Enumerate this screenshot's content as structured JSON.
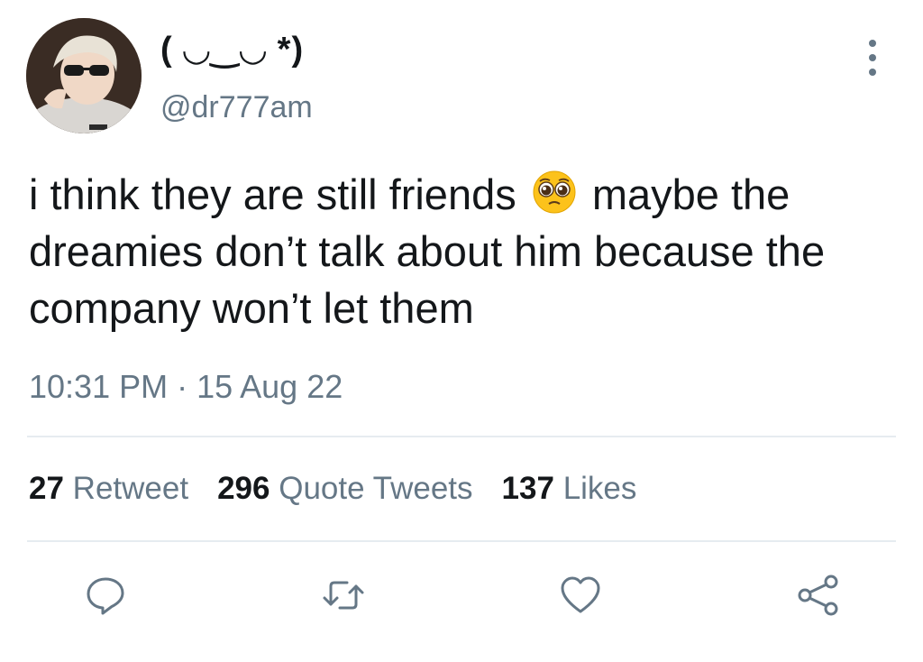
{
  "user": {
    "display_name": "( ◡‿◡ *)",
    "handle": "@dr777am"
  },
  "tweet": {
    "text_before_emoji": "i think they are still friends",
    "emoji": "pleading-face-emoji",
    "text_after_emoji": "maybe the dreamies don’t talk about him because the company won’t let them",
    "timestamp": "10:31 PM · 15 Aug 22"
  },
  "stats": {
    "retweets_count": "27",
    "retweets_label": "Retweet",
    "quotes_count": "296",
    "quotes_label": "Quote Tweets",
    "likes_count": "137",
    "likes_label": "Likes"
  },
  "actions": {
    "icons": [
      "reply-icon",
      "retweet-icon",
      "like-icon",
      "share-icon"
    ],
    "icon_color": "#657786"
  },
  "colors": {
    "text_primary": "#14171a",
    "text_secondary": "#657786",
    "divider": "#e6ecf0"
  }
}
